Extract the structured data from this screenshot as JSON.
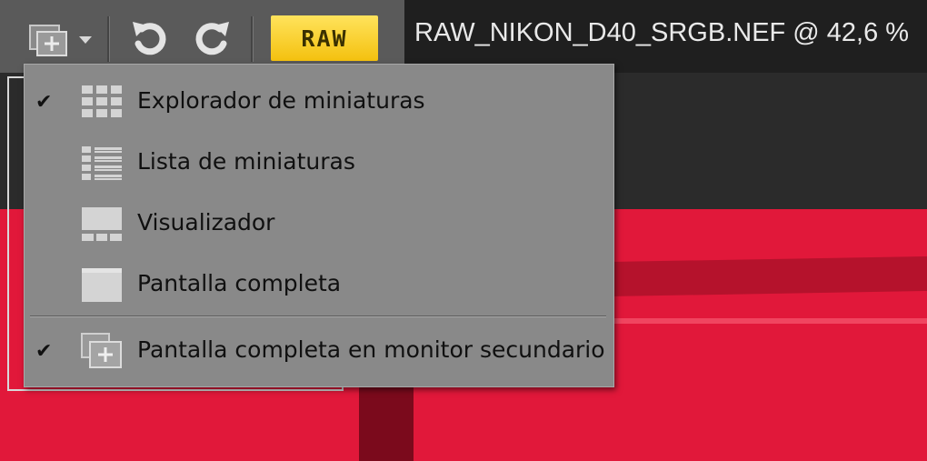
{
  "toolbar": {
    "raw_badge": "RAW",
    "file_title": "RAW_NIKON_D40_SRGB.NEF @ 42,6 %",
    "icons": [
      "display-mode-icon",
      "dropdown-arrow-icon",
      "rotate-left-icon",
      "rotate-right-icon"
    ]
  },
  "menu": {
    "items": [
      {
        "label": "Explorador de miniaturas",
        "checked": true,
        "icon": "thumbnail-grid-icon"
      },
      {
        "label": "Lista de miniaturas",
        "checked": false,
        "icon": "thumbnail-list-icon"
      },
      {
        "label": "Visualizador",
        "checked": false,
        "icon": "viewer-icon"
      },
      {
        "label": "Pantalla completa",
        "checked": false,
        "icon": "fullscreen-icon"
      },
      {
        "label": "Pantalla completa en monitor secundario",
        "checked": true,
        "icon": "secondary-monitor-icon"
      }
    ],
    "check_glyph": "✔"
  },
  "colors": {
    "badge": "#f4c10f",
    "menu_bg": "#898989",
    "photo_red": "#e1183a"
  }
}
